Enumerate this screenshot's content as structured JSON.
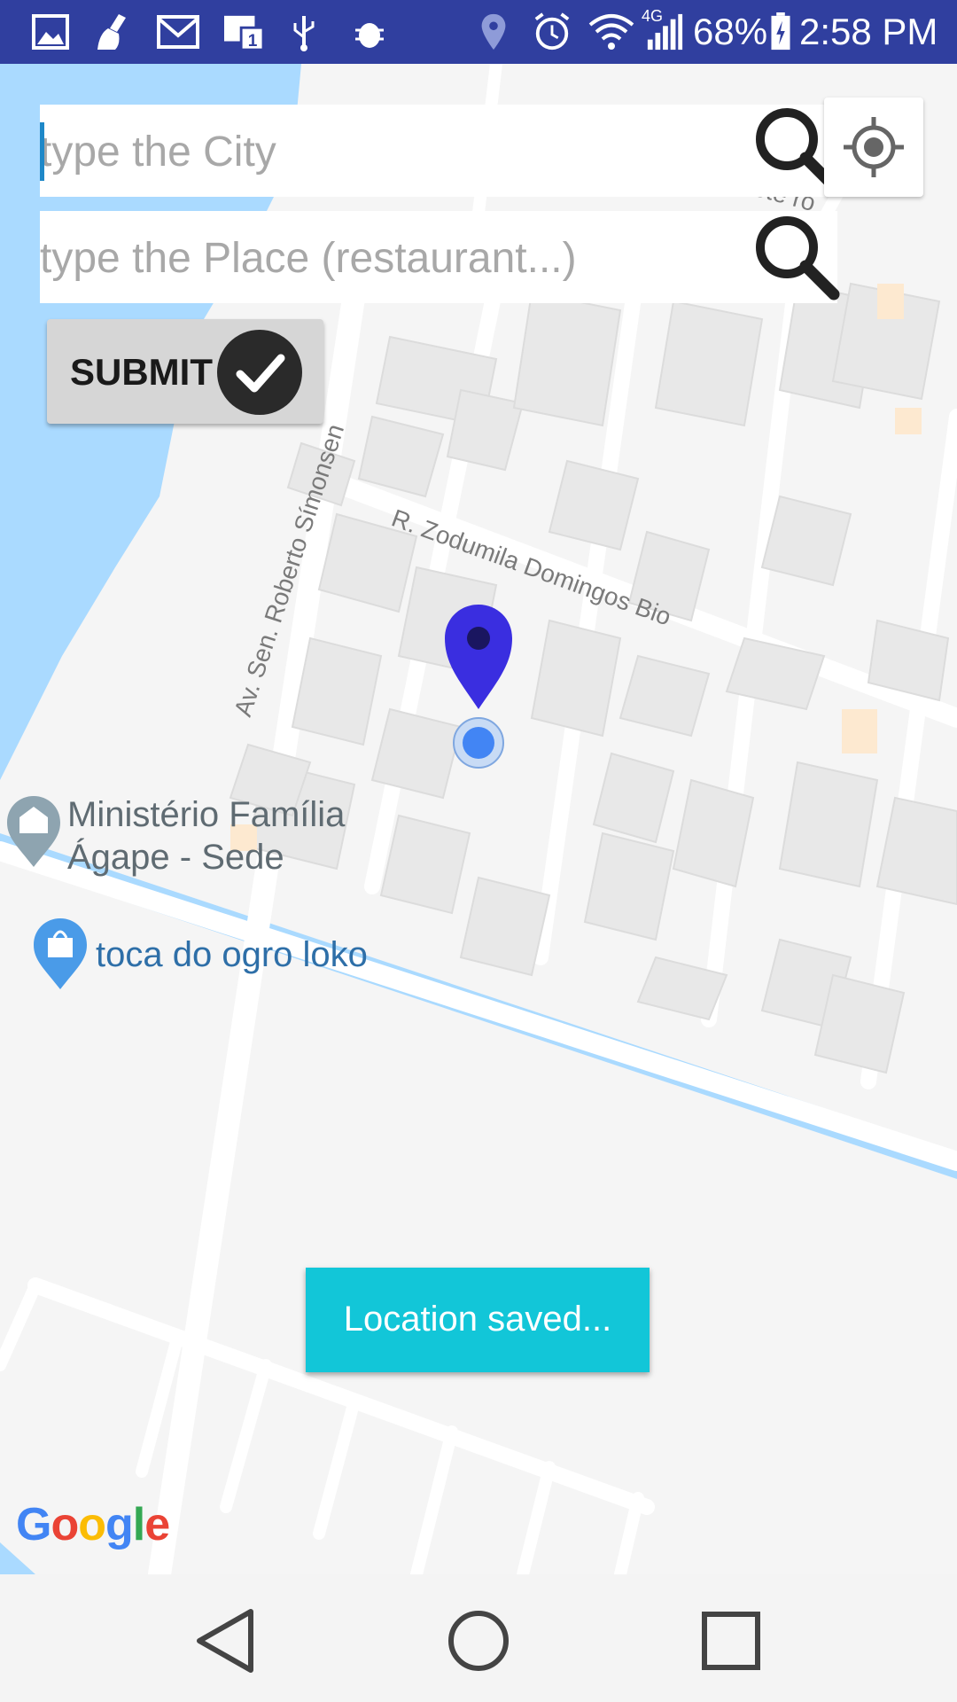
{
  "status_bar": {
    "battery": "68%",
    "time": "2:58 PM",
    "network": "4G",
    "icons": [
      "image-icon",
      "cleaner-icon",
      "gmail-icon",
      "calendar-icon",
      "usb-icon",
      "bug-icon",
      "location-icon",
      "alarm-icon",
      "wifi-icon",
      "signal-icon",
      "battery-icon"
    ]
  },
  "search": {
    "city_placeholder": "type the City",
    "place_placeholder": "type the Place (restaurant...)"
  },
  "submit": {
    "label": "SUBMIT"
  },
  "map": {
    "road_labels": [
      "R. Zodumila Domingos Bio",
      "Av. Sen. Roberto Símonsen"
    ],
    "partial_label": "Sete ro",
    "poi": [
      {
        "line1": "Ministério Família",
        "line2": "Ágape - Sede",
        "icon": "church-pin-icon"
      },
      {
        "line1": "toca do ogro loko",
        "icon": "shopping-pin-icon"
      }
    ],
    "attribution": "Google"
  },
  "toast": {
    "text": "Location saved..."
  },
  "colors": {
    "status_bar": "#303f9f",
    "toast": "#12c6d8",
    "marker": "#3a2ee0",
    "water": "#aadaff"
  },
  "nav": [
    "back-icon",
    "home-icon",
    "recents-icon"
  ]
}
